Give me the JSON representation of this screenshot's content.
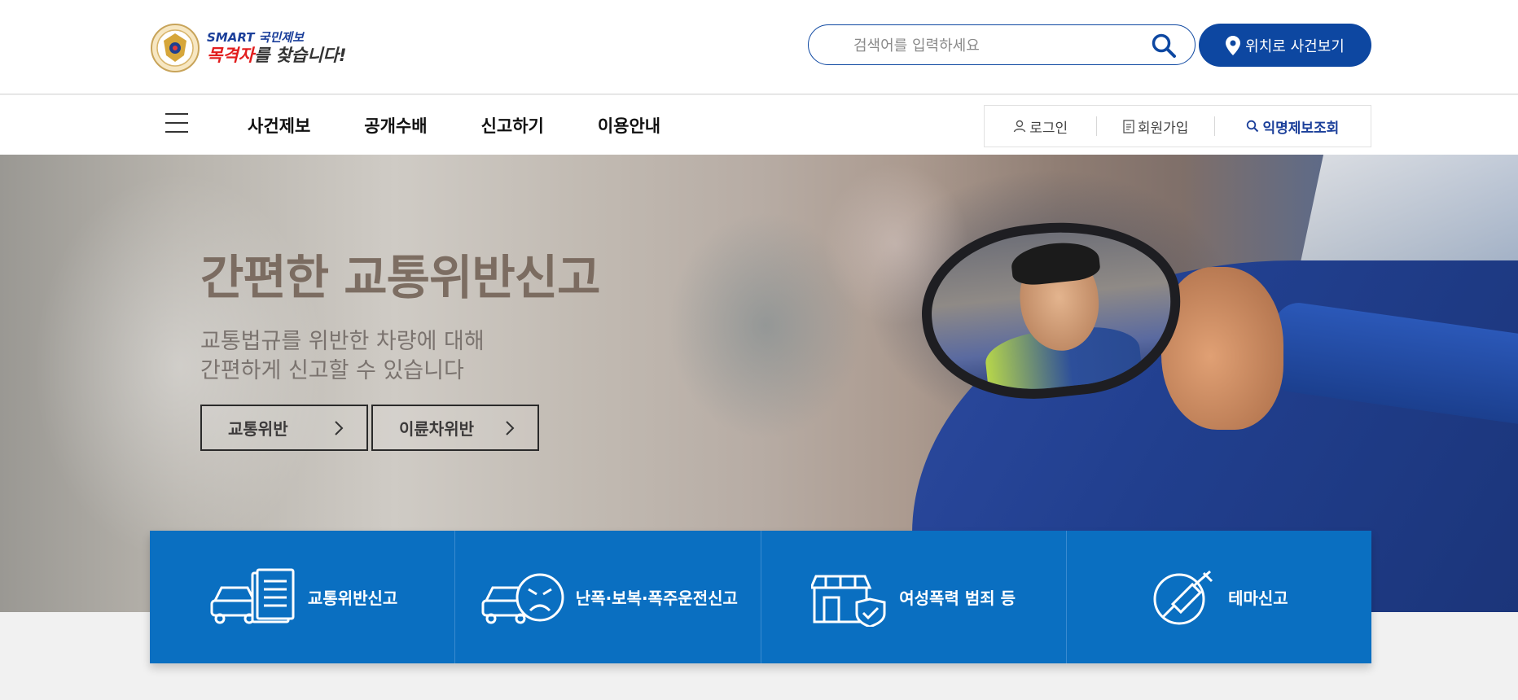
{
  "header": {
    "logo": {
      "line1": "SMART 국민제보",
      "line2_red": "목격자",
      "line2_rest": "를 찾습니다!"
    },
    "search": {
      "placeholder": "검색어를 입력하세요",
      "value": ""
    },
    "location_button": "위치로 사건보기"
  },
  "nav": {
    "menu": [
      "사건제보",
      "공개수배",
      "신고하기",
      "이용안내"
    ],
    "util": {
      "login": "로그인",
      "signup": "회원가입",
      "anon_lookup": "익명제보조회"
    }
  },
  "hero": {
    "title": "간편한 교통위반신고",
    "sub1": "교통법규를 위반한 차량에 대해",
    "sub2": "간편하게 신고할 수 있습니다",
    "buttons": [
      "교통위반",
      "이륜차위반"
    ]
  },
  "quick": [
    "교통위반신고",
    "난폭·보복·폭주운전신고",
    "여성폭력 범죄 등",
    "테마신고"
  ],
  "colors": {
    "primary": "#0d47a1",
    "quickbar": "#0a6fc1",
    "logo_red": "#e21d1d"
  },
  "icons": [
    "search-icon",
    "location-pin-icon",
    "hamburger-icon",
    "user-icon",
    "document-icon",
    "magnifier-icon",
    "chevron-right-icon",
    "car-report-icon",
    "angry-car-icon",
    "shop-shield-icon",
    "syringe-no-icon"
  ]
}
